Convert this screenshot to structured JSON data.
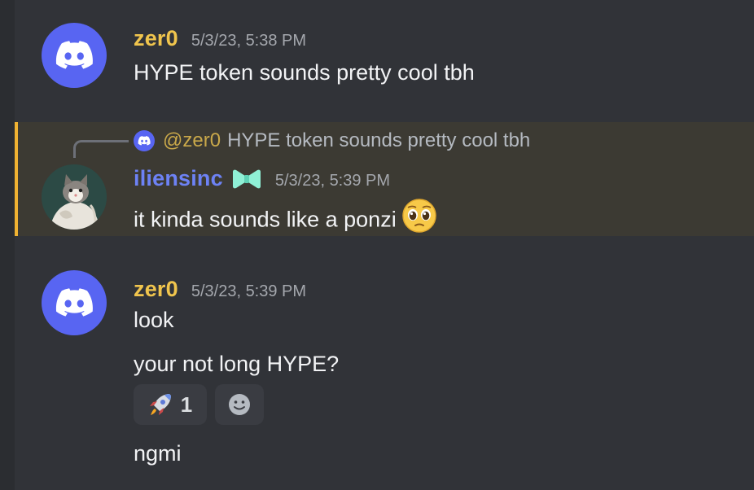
{
  "messages": [
    {
      "author": "zer0",
      "timestamp": "5/3/23, 5:38 PM",
      "lines": [
        "HYPE token sounds pretty cool tbh"
      ]
    },
    {
      "reply": {
        "mention": "@zer0",
        "text": "HYPE token sounds pretty cool tbh"
      },
      "author": "iliensinc",
      "timestamp": "5/3/23, 5:39 PM",
      "lines": [
        "it kinda sounds like a ponzi"
      ],
      "emoji": "pleading-face"
    },
    {
      "author": "zer0",
      "timestamp": "5/3/23, 5:39 PM",
      "lines": [
        "look",
        "your not long HYPE?",
        "ngmi"
      ],
      "reactions": [
        {
          "emoji": "rocket-icon",
          "count": "1"
        }
      ]
    }
  ],
  "colors": {
    "background": "#313338",
    "highlight": "#3c3a33",
    "highlight_bar": "#f0b232",
    "username_zer0": "#f0c54d",
    "username_iliensinc": "#6d82f5",
    "blurple": "#5865f2"
  }
}
